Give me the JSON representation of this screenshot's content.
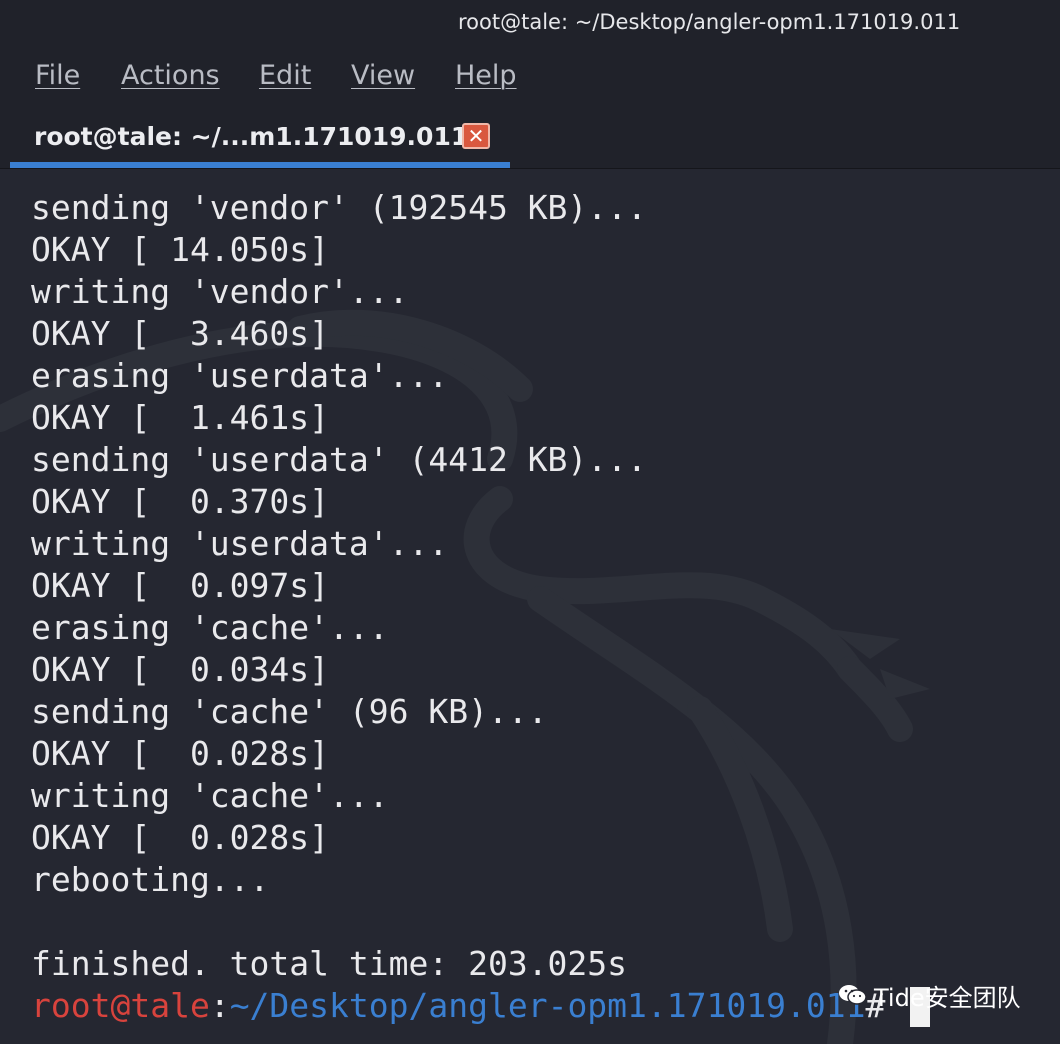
{
  "window": {
    "title": "root@tale: ~/Desktop/angler-opm1.171019.011"
  },
  "menu": {
    "items": [
      "File",
      "Actions",
      "Edit",
      "View",
      "Help"
    ]
  },
  "tab": {
    "label": "root@tale: ~/...m1.171019.011",
    "close_icon": "close-icon"
  },
  "terminal": {
    "lines": [
      "sending 'vendor' (192545 KB)...",
      "OKAY [ 14.050s]",
      "writing 'vendor'...",
      "OKAY [  3.460s]",
      "erasing 'userdata'...",
      "OKAY [  1.461s]",
      "sending 'userdata' (4412 KB)...",
      "OKAY [  0.370s]",
      "writing 'userdata'...",
      "OKAY [  0.097s]",
      "erasing 'cache'...",
      "OKAY [  0.034s]",
      "sending 'cache' (96 KB)...",
      "OKAY [  0.028s]",
      "writing 'cache'...",
      "OKAY [  0.028s]",
      "rebooting...",
      "",
      "finished. total time: 203.025s"
    ],
    "prompt": {
      "user": "root@tale",
      "separator": ":",
      "path": "~/Desktop/angler-opm1.171019.011",
      "symbol": "#"
    }
  },
  "watermark": {
    "text": "Tide安全团队",
    "icon": "wechat-icon"
  },
  "colors": {
    "background": "#252731",
    "chrome": "#20222a",
    "accent": "#3a7fd1",
    "prompt_user": "#d8433d",
    "text": "#e9e9ec"
  }
}
